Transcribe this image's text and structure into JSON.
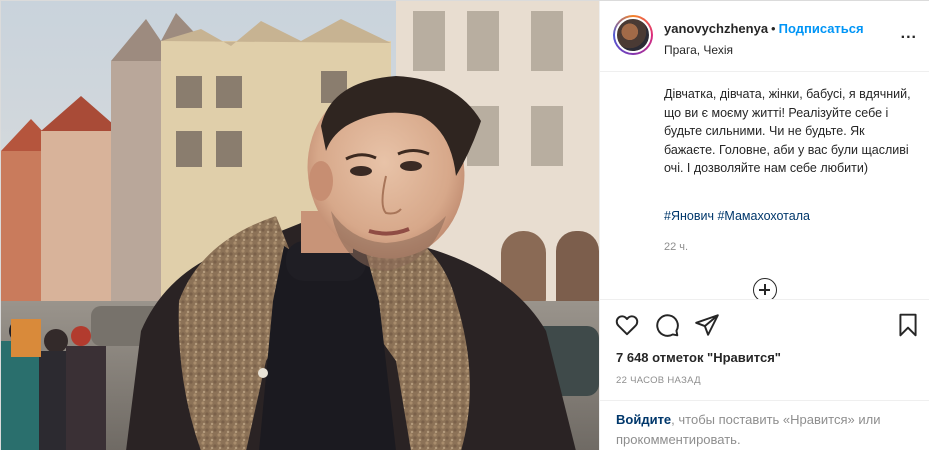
{
  "header": {
    "username": "yanovychzhenya",
    "separator": "•",
    "follow_label": "Подписаться",
    "location": "Прага, Чехія",
    "more_label": "..."
  },
  "caption": {
    "text": "Дівчатка, дівчата, жінки, бабусі, я вдячний, що ви є моєму житті! Реалізуйте себе і будьте сильними. Чи не будьте. Як бажаєте. Головне, аби у вас були щасливі очі. І дозволяйте нам себе любити)",
    "hashtags": [
      "#Янович",
      "#Мамахохотала"
    ],
    "time_ago": "22 ч."
  },
  "actions": {
    "likes": "7 648 отметок \"Нравится\"",
    "posted": "22 ЧАСОВ НАЗАД",
    "login_link": "Войдите",
    "login_rest": ", чтобы поставить «Нравится» или прокомментировать."
  },
  "icons": {
    "like": "heart-icon",
    "comment": "comment-icon",
    "share": "paper-plane-icon",
    "save": "bookmark-icon",
    "load_more": "plus-circle-icon"
  }
}
